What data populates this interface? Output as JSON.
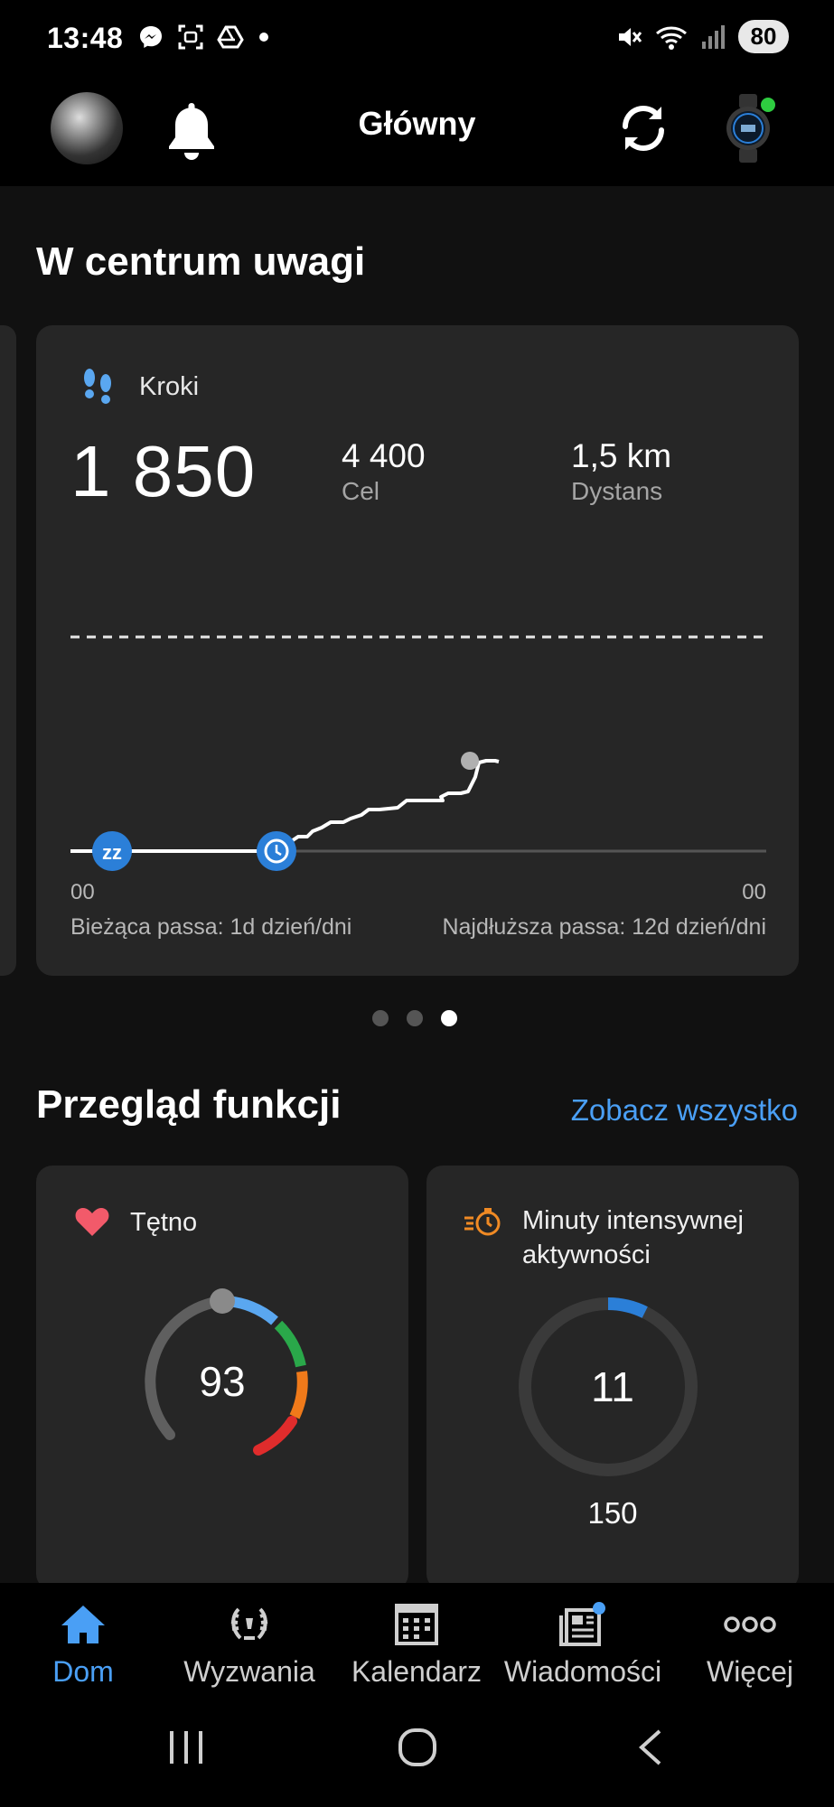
{
  "status_bar": {
    "time": "13:48",
    "battery": "80",
    "left_icons": [
      "messenger-icon",
      "screenshot-icon",
      "drive-icon",
      "dot-icon"
    ],
    "right_icons": [
      "mute-icon",
      "wifi-icon",
      "signal-icon"
    ]
  },
  "header": {
    "title": "Główny"
  },
  "spotlight": {
    "section_title": "W centrum uwagi",
    "card": {
      "label": "Kroki",
      "steps": "1 850",
      "goal_value": "4 400",
      "goal_label": "Cel",
      "distance_value": "1,5 km",
      "distance_label": "Dystans",
      "axis_start": "00",
      "axis_end": "00",
      "current_streak": "Bieżąca passa: 1d dzień/dni",
      "longest_streak": "Najdłuższa passa: 12d dzień/dni",
      "sleep_marker_text": "zz",
      "accent_color": "#2b7fd8"
    },
    "pager": {
      "count": 3,
      "active": 3
    }
  },
  "features": {
    "section_title": "Przegląd funkcji",
    "see_all": "Zobacz wszystko",
    "heart_rate": {
      "label": "Tętno",
      "value": "93",
      "zone_colors": [
        "#5aa7f0",
        "#2aa84a",
        "#f07a1a",
        "#e02c2c"
      ]
    },
    "intensity": {
      "label_line1": "Minuty intensywnej",
      "label_line2": "aktywności",
      "value": "11",
      "goal": "150",
      "progress": 0.073
    }
  },
  "bottom_nav": {
    "items": [
      {
        "label": "Dom",
        "icon": "home-icon",
        "active": true
      },
      {
        "label": "Wyzwania",
        "icon": "laurel-icon",
        "active": false
      },
      {
        "label": "Kalendarz",
        "icon": "calendar-icon",
        "active": false
      },
      {
        "label": "Wiadomości",
        "icon": "news-icon",
        "active": false
      },
      {
        "label": "Więcej",
        "icon": "more-icon",
        "active": false
      }
    ]
  }
}
